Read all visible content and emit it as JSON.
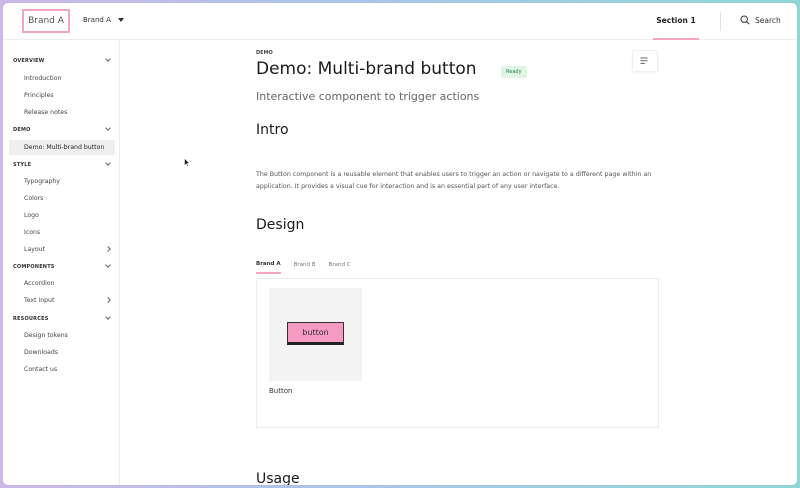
{
  "header": {
    "logo_text": "Brand A",
    "brand_select": "Brand A",
    "section_tab": "Section 1",
    "search_label": "Search"
  },
  "sidebar": {
    "groups": [
      {
        "label": "OVERVIEW",
        "items": [
          "Introduction",
          "Principles",
          "Release notes"
        ]
      },
      {
        "label": "DEMO",
        "items": [
          "Demo: Multi-brand button"
        ]
      },
      {
        "label": "STYLE",
        "items": [
          "Typography",
          "Colors",
          "Logo",
          "Icons",
          "Layout"
        ]
      },
      {
        "label": "COMPONENTS",
        "items": [
          "Accordion",
          "Text input"
        ]
      },
      {
        "label": "RESOURCES",
        "items": [
          "Design tokens",
          "Downloads",
          "Contact us"
        ]
      }
    ],
    "active_item": "Demo: Multi-brand button"
  },
  "main": {
    "overline": "DEMO",
    "title": "Demo: Multi-brand button",
    "status_badge": "Ready",
    "subtitle": "Interactive component to trigger actions",
    "intro_heading": "Intro",
    "intro_text": "The Button component is a reusable element that enables users to trigger an action or navigate to a different page within an application. It provides a visual cue for interaction and is an essential part of any user interface.",
    "design_heading": "Design",
    "design_tabs": [
      "Brand A",
      "Brand B",
      "Brand C"
    ],
    "active_design_tab": "Brand A",
    "demo_button_label": "button",
    "preview_caption": "Button",
    "usage_heading": "Usage"
  },
  "colors": {
    "accent_pink": "#f2a6bf",
    "button_fill": "#f59ac0",
    "badge_bg": "#dff6e7",
    "badge_text": "#2a7a4b"
  }
}
